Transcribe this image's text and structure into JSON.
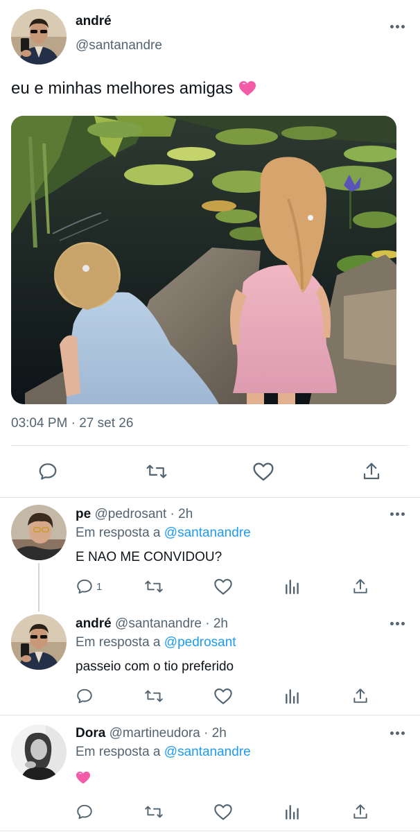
{
  "main_tweet": {
    "display_name": "andré",
    "handle": "@santanandre",
    "text": "eu e minhas melhores amigas",
    "emoji": "💗",
    "timestamp": "03:04 PM · 27 set 26",
    "actions": [
      "reply-icon",
      "retweet-icon",
      "like-icon",
      "share-icon"
    ]
  },
  "replies": [
    {
      "display_name": "pe",
      "handle": "@pedrosant",
      "time": "2h",
      "reply_prefix": "Em resposta a",
      "reply_to": "@santanandre",
      "text": "E NAO ME CONVIDOU?",
      "reply_count": "1"
    },
    {
      "display_name": "andré",
      "handle": "@santanandre",
      "time": "2h",
      "reply_prefix": "Em resposta a",
      "reply_to": "@pedrosant",
      "text": "passeio com o tio preferido",
      "reply_count": ""
    },
    {
      "display_name": "Dora",
      "handle": "@martineudora",
      "time": "2h",
      "reply_prefix": "Em resposta a",
      "reply_to": "@santanandre",
      "text": "💗",
      "reply_count": ""
    }
  ],
  "separator": " · ",
  "colors": {
    "text": "#0f1419",
    "secondary": "#536471",
    "link": "#1d9bf0",
    "divider": "#e1e5e9",
    "heart": "#f25ba8"
  }
}
